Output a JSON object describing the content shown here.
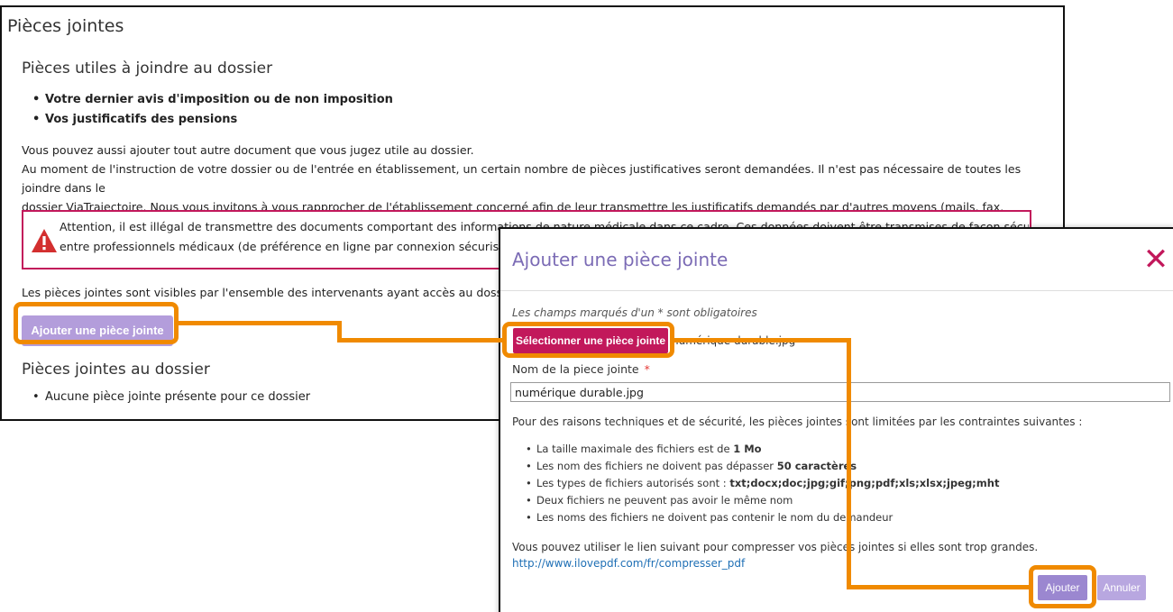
{
  "background": {
    "title": "Pièces jointes",
    "useful_heading": "Pièces utiles à joindre au dossier",
    "useful_items": [
      "Votre dernier avis d'imposition ou de non imposition",
      "Vos justificatifs des pensions"
    ],
    "info_line1": "Vous pouvez aussi ajouter tout autre document que vous jugez utile au dossier.",
    "info_line2": "Au moment de l'instruction de votre dossier ou de l'entrée en établissement, un certain nombre de pièces justificatives seront demandées. Il n'est pas nécessaire de toutes les joindre dans le",
    "info_line3": "dossier ViaTrajectoire. Nous vous invitons à vous rapprocher de l'établissement concerné afin de leur transmettre les justificatifs demandés par d'autres moyens (mails, fax, courrier...).",
    "alert_line1": "Attention, il est illégal de transmettre des documents comportant des informations de nature médicale dans ce cadre. Ces données doivent être transmises de façon sécurisée",
    "alert_line2": "entre professionnels médicaux (de préférence en ligne par connexion sécurisée ou",
    "visibility_text": "Les pièces jointes sont visibles par l'ensemble des intervenants ayant accès au dossier.",
    "add_button": "Ajouter une pièce jointe",
    "attached_heading": "Pièces jointes au dossier",
    "attached_items": [
      "Aucune pièce jointe présente pour ce dossier"
    ]
  },
  "modal": {
    "title": "Ajouter une pièce jointe",
    "close_symbol": "✕",
    "required_note": "Les champs marqués d'un * sont obligatoires",
    "select_button": "Sélectionner une pièce jointe",
    "selected_filename": "numérique durable.jpg",
    "name_label": "Nom de la piece jointe",
    "required_marker": "*",
    "name_value": "numérique durable.jpg",
    "constraints_intro": "Pour des raisons techniques et de sécurité, les pièces jointes sont limitées par les contraintes suivantes :",
    "constraints": [
      {
        "text": "La taille maximale des fichiers est de ",
        "bold": "1 Mo"
      },
      {
        "text": "Les nom des fichiers ne doivent pas dépasser ",
        "bold": "50 caractères"
      },
      {
        "text": "Les types de fichiers autorisés sont : ",
        "bold": "txt;docx;doc;jpg;gif;png;pdf;xls;xlsx;jpeg;mht"
      },
      {
        "text": "Deux fichiers ne peuvent pas avoir le même nom",
        "bold": ""
      },
      {
        "text": "Les noms des fichiers ne doivent pas contenir le nom du demandeur",
        "bold": ""
      }
    ],
    "compress_text": "Vous pouvez utiliser le lien suivant pour compresser vos pièces jointes si elles sont trop grandes.",
    "compress_link": "http://www.ilovepdf.com/fr/compresser_pdf",
    "ok_button": "Ajouter",
    "cancel_button": "Annuler"
  },
  "colors": {
    "highlight": "#f08a00",
    "accent_magenta": "#c2185b",
    "button_purple": "#b39ddb",
    "title_purple": "#7b6bb5"
  }
}
